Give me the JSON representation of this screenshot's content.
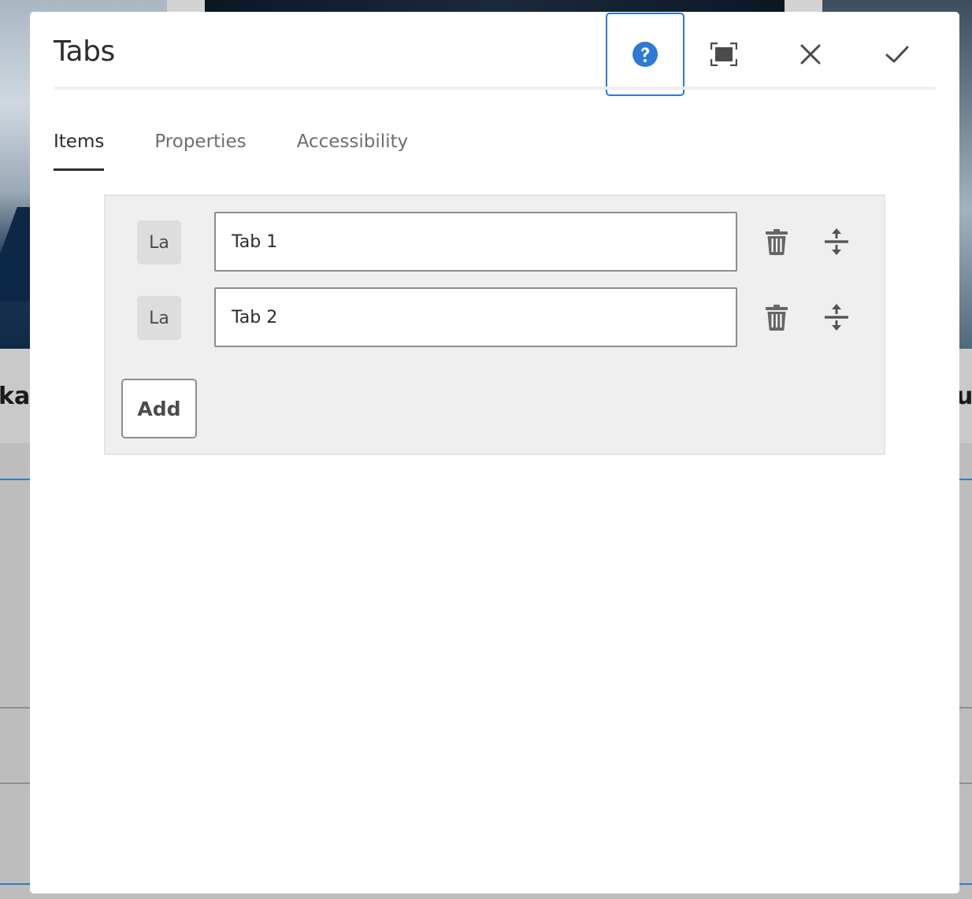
{
  "dialog": {
    "title": "Tabs",
    "buttons": {
      "help": "help-icon",
      "fullscreen": "fullscreen-icon",
      "close": "close-icon",
      "done": "checkmark-icon"
    },
    "accent_color": "#2c7ad6"
  },
  "tabs": [
    {
      "label": "Items",
      "active": true
    },
    {
      "label": "Properties",
      "active": false
    },
    {
      "label": "Accessibility",
      "active": false
    }
  ],
  "items": [
    {
      "label_badge": "La",
      "value": "Tab 1"
    },
    {
      "label_badge": "La",
      "value": "Tab 2"
    }
  ],
  "add_label": "Add",
  "background": {
    "caption_left": "ka",
    "caption_right": "u"
  }
}
